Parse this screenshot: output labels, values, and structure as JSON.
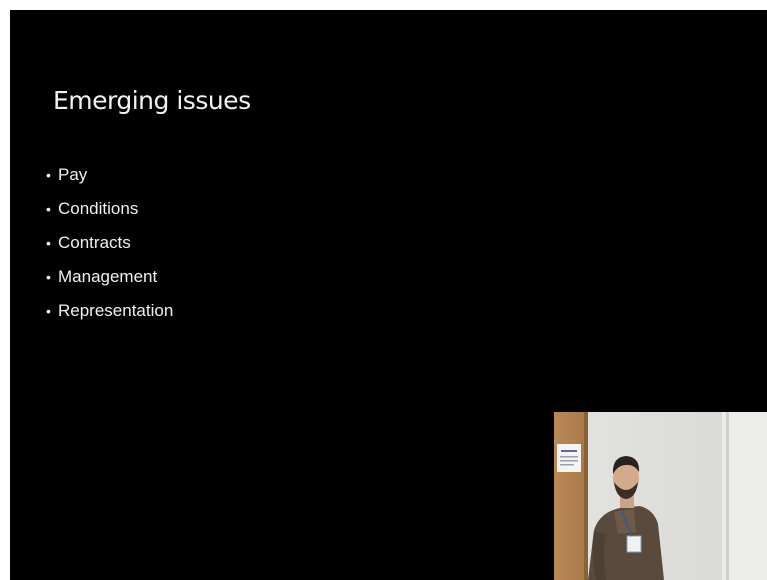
{
  "slide": {
    "title": "Emerging issues",
    "bullet_symbol": "•",
    "bullets": [
      "Pay",
      "Conditions",
      "Contracts",
      "Management",
      "Representation"
    ]
  },
  "colors": {
    "slide_background": "#000000",
    "slide_text": "#f0f0f0",
    "frame_border": "#ffffff"
  },
  "webcam": {
    "subject": "presenter-video"
  }
}
